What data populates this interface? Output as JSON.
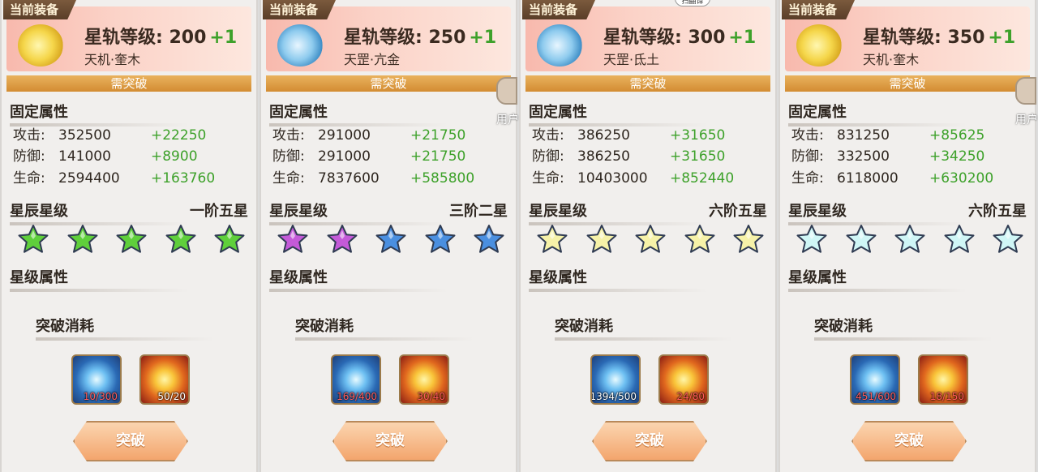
{
  "top_hint": "扫翻译",
  "side_hint": "用户",
  "labels": {
    "current_equip": "当前装备",
    "need_breakthrough": "需突破",
    "fixed_attr": "固定属性",
    "star_rank": "星辰星级",
    "star_attr": "星级属性",
    "break_cost": "突破消耗",
    "break_button": "突破",
    "attack": "攻击:",
    "defense": "防御:",
    "life": "生命:"
  },
  "panels": [
    {
      "title": "星轨等级: 200",
      "plus": "+1",
      "subtitle": "天机·奎木",
      "icon": "yellow-orb-icon",
      "attrs": {
        "attack": "352500",
        "attack_add": "+22250",
        "defense": "141000",
        "defense_add": "+8900",
        "life": "2594400",
        "life_add": "+163760"
      },
      "star_level": "一阶五星",
      "stars": [
        "#5fcf3b",
        "#5fcf3b",
        "#5fcf3b",
        "#5fcf3b",
        "#5fcf3b"
      ],
      "mat_blue": "10/300",
      "mat_red": "50/20",
      "mat_blue_short": true,
      "mat_red_short": false
    },
    {
      "title": "星轨等级: 250",
      "plus": "+1",
      "subtitle": "天罡·亢金",
      "icon": "blue-teapot-icon",
      "attrs": {
        "attack": "291000",
        "attack_add": "+21750",
        "defense": "291000",
        "defense_add": "+21750",
        "life": "7837600",
        "life_add": "+585800"
      },
      "star_level": "三阶二星",
      "stars": [
        "#c45ad8",
        "#c45ad8",
        "#4a8fe0",
        "#4a8fe0",
        "#4a8fe0"
      ],
      "mat_blue": "169/400",
      "mat_red": "30/40",
      "mat_blue_short": true,
      "mat_red_short": true
    },
    {
      "title": "星轨等级: 300",
      "plus": "+1",
      "subtitle": "天罡·氐土",
      "icon": "blue-teapot-icon",
      "attrs": {
        "attack": "386250",
        "attack_add": "+31650",
        "defense": "386250",
        "defense_add": "+31650",
        "life": "10403000",
        "life_add": "+852440"
      },
      "star_level": "六阶五星",
      "stars": [
        "#f6f2a8",
        "#f6f2a8",
        "#f6f2a8",
        "#f6f2a8",
        "#f6f2a8"
      ],
      "mat_blue": "1394/500",
      "mat_red": "24/80",
      "mat_blue_short": false,
      "mat_red_short": true
    },
    {
      "title": "星轨等级: 350",
      "plus": "+1",
      "subtitle": "天机·奎木",
      "icon": "yellow-orb-icon",
      "attrs": {
        "attack": "831250",
        "attack_add": "+85625",
        "defense": "332500",
        "defense_add": "+34250",
        "life": "6118000",
        "life_add": "+630200"
      },
      "star_level": "六阶五星",
      "stars": [
        "#cff6f6",
        "#cff6f6",
        "#cff6f6",
        "#cff6f6",
        "#cff6f6"
      ],
      "mat_blue": "451/600",
      "mat_red": "18/150",
      "mat_blue_short": true,
      "mat_red_short": true
    }
  ]
}
